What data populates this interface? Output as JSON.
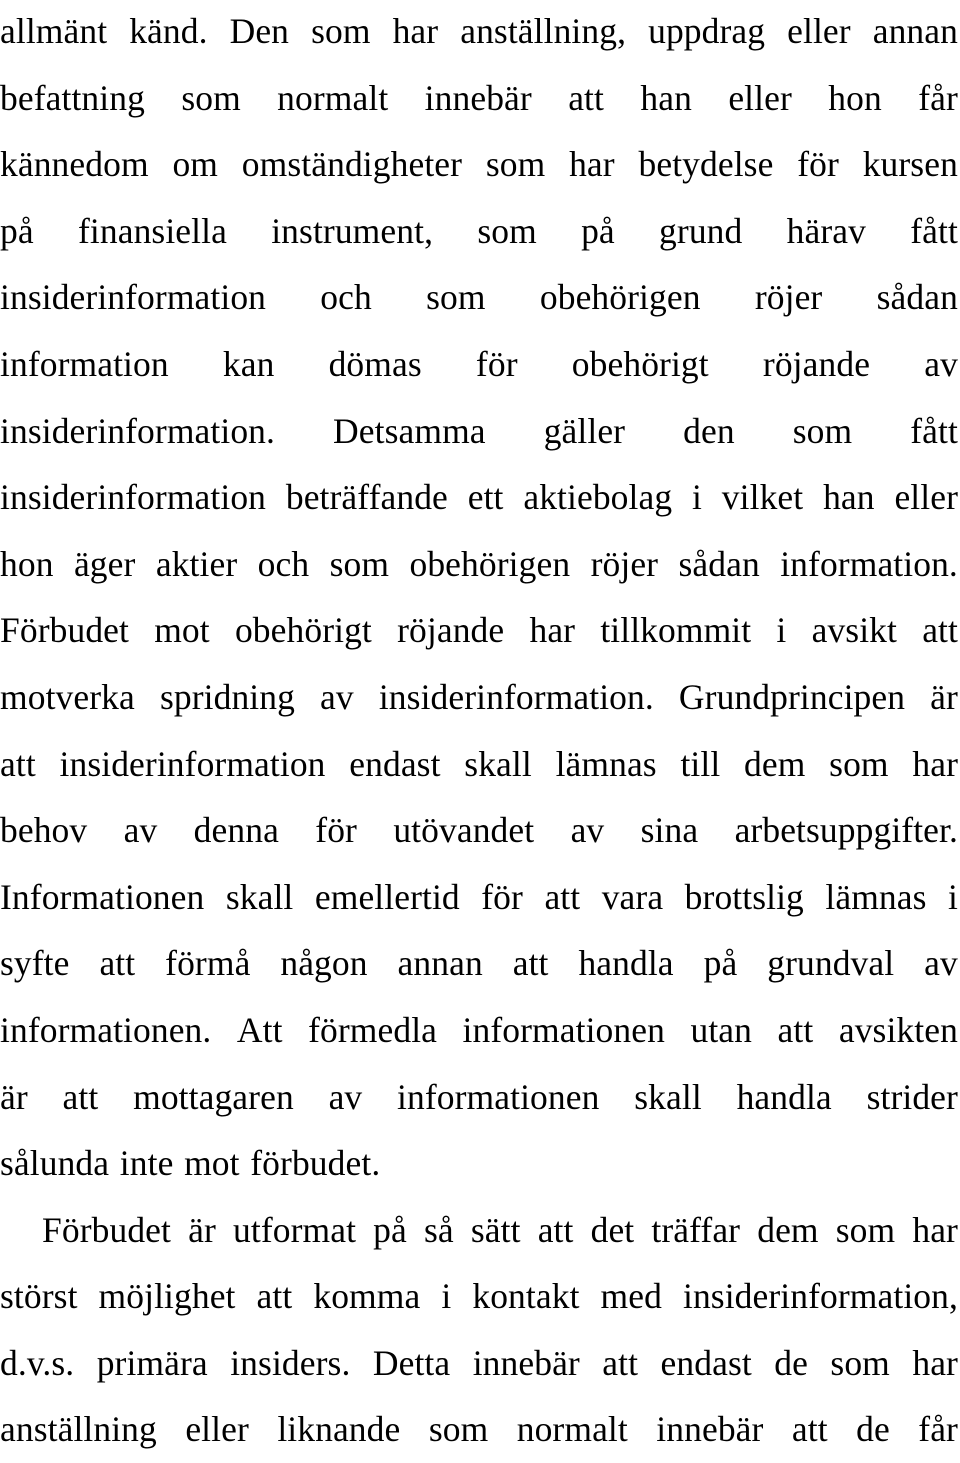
{
  "document": {
    "language": "Swedish",
    "page_background": "#ffffff",
    "text_color": "#000000",
    "alignment": "justified",
    "paragraph_count": 2,
    "line_count": 21,
    "paragraphs": [
      {
        "id": "paragraph-insiderinformation",
        "indent_first_line": false,
        "text": "allmänt känd. Den som har anställning, uppdrag eller annan befattning som normalt innebär att han eller hon får kännedom om omständigheter som har betydelse för kursen på finansiella instrument, som på grund härav fått insiderinformation och som obehörigen röjer sådan information kan dömas för obehörigt röjande av insiderinformation. Detsamma gäller den som fått insiderinformation beträffande ett aktiebolag i vilket han eller hon äger aktier och som obehörigen röjer sådan information. Förbudet mot obehörigt röjande har tillkommit i avsikt att motverka spridning av insiderinformation. Grundprincipen är att insiderinformation endast skall lämnas till dem som har behov av denna för utövandet av sina arbetsuppgifter. Informationen skall emellertid för att vara brottslig lämnas i syfte att förmå någon annan att handla på grundval av informationen. Att förmedla informationen utan att avsikten är att mottagaren av informationen skall handla strider sålunda inte mot förbudet.",
        "lines": [
          {
            "words": [
              "allmänt",
              "känd.",
              "Den",
              "som",
              "har",
              "anställning,",
              "uppdrag",
              "eller",
              "annan"
            ],
            "justified": true,
            "indent": false
          },
          {
            "words": [
              "befattning",
              "som",
              "normalt",
              "innebär",
              "att",
              "han",
              "eller",
              "hon",
              "får"
            ],
            "justified": true,
            "indent": false
          },
          {
            "words": [
              "kännedom",
              "om",
              "omständigheter",
              "som",
              "har",
              "betydelse",
              "för",
              "kursen"
            ],
            "justified": true,
            "indent": false
          },
          {
            "words": [
              "på",
              "finansiella",
              "instrument,",
              "som",
              "på",
              "grund",
              "härav",
              "fått"
            ],
            "justified": true,
            "indent": false
          },
          {
            "words": [
              "insiderinformation",
              "och",
              "som",
              "obehörigen",
              "röjer",
              "sådan"
            ],
            "justified": true,
            "indent": false
          },
          {
            "words": [
              "information",
              "kan",
              "dömas",
              "för",
              "obehörigt",
              "röjande",
              "av"
            ],
            "justified": true,
            "indent": false
          },
          {
            "words": [
              "insiderinformation.",
              "Detsamma",
              "gäller",
              "den",
              "som",
              "fått"
            ],
            "justified": true,
            "indent": false
          },
          {
            "words": [
              "insiderinformation",
              "beträffande",
              "ett",
              "aktiebolag",
              "i",
              "vilket",
              "han",
              "eller"
            ],
            "justified": true,
            "indent": false
          },
          {
            "words": [
              "hon",
              "äger",
              "aktier",
              "och",
              "som",
              "obehörigen",
              "röjer",
              "sådan",
              "information."
            ],
            "justified": true,
            "indent": false
          },
          {
            "words": [
              "Förbudet",
              "mot",
              "obehörigt",
              "röjande",
              "har",
              "tillkommit",
              "i",
              "avsikt",
              "att"
            ],
            "justified": true,
            "indent": false
          },
          {
            "words": [
              "motverka",
              "spridning",
              "av",
              "insiderinformation.",
              "Grundprincipen",
              "är"
            ],
            "justified": true,
            "indent": false
          },
          {
            "words": [
              "att",
              "insiderinformation",
              "endast",
              "skall",
              "lämnas",
              "till",
              "dem",
              "som",
              "har"
            ],
            "justified": true,
            "indent": false
          },
          {
            "words": [
              "behov",
              "av",
              "denna",
              "för",
              "utövandet",
              "av",
              "sina",
              "arbetsuppgifter."
            ],
            "justified": true,
            "indent": false
          },
          {
            "words": [
              "Informationen",
              "skall",
              "emellertid",
              "för",
              "att",
              "vara",
              "brottslig",
              "lämnas",
              "i"
            ],
            "justified": true,
            "indent": false
          },
          {
            "words": [
              "syfte",
              "att",
              "förmå",
              "någon",
              "annan",
              "att",
              "handla",
              "på",
              "grundval",
              "av"
            ],
            "justified": true,
            "indent": false
          },
          {
            "words": [
              "informationen.",
              "Att",
              "förmedla",
              "informationen",
              "utan",
              "att",
              "avsikten"
            ],
            "justified": true,
            "indent": false
          },
          {
            "words": [
              "är",
              "att",
              "mottagaren",
              "av",
              "informationen",
              "skall",
              "handla",
              "strider"
            ],
            "justified": true,
            "indent": false
          },
          {
            "words": [
              "sålunda",
              "inte",
              "mot",
              "förbudet."
            ],
            "justified": false,
            "indent": false
          }
        ]
      },
      {
        "id": "paragraph-primara-insiders",
        "indent_first_line": true,
        "text": "Förbudet är utformat på så sätt att det träffar dem som har störst möjlighet att komma i kontakt med insiderinformation, d.v.s. primära insiders. Detta innebär att endast de som har anställning eller liknande som normalt innebär att de får",
        "lines": [
          {
            "words": [
              "Förbudet",
              "är",
              "utformat",
              "på",
              "så",
              "sätt",
              "att",
              "det",
              "träffar",
              "dem",
              "som",
              "har"
            ],
            "justified": true,
            "indent": true
          },
          {
            "words": [
              "störst",
              "möjlighet",
              "att",
              "komma",
              "i",
              "kontakt",
              "med",
              "insiderinformation,"
            ],
            "justified": true,
            "indent": false
          },
          {
            "words": [
              "d.v.s.",
              "primära",
              "insiders.",
              "Detta",
              "innebär",
              "att",
              "endast",
              "de",
              "som",
              "har"
            ],
            "justified": true,
            "indent": false
          },
          {
            "words": [
              "anställning",
              "eller",
              "liknande",
              "som",
              "normalt",
              "innebär",
              "att",
              "de",
              "får"
            ],
            "justified": true,
            "indent": false
          }
        ]
      }
    ]
  }
}
